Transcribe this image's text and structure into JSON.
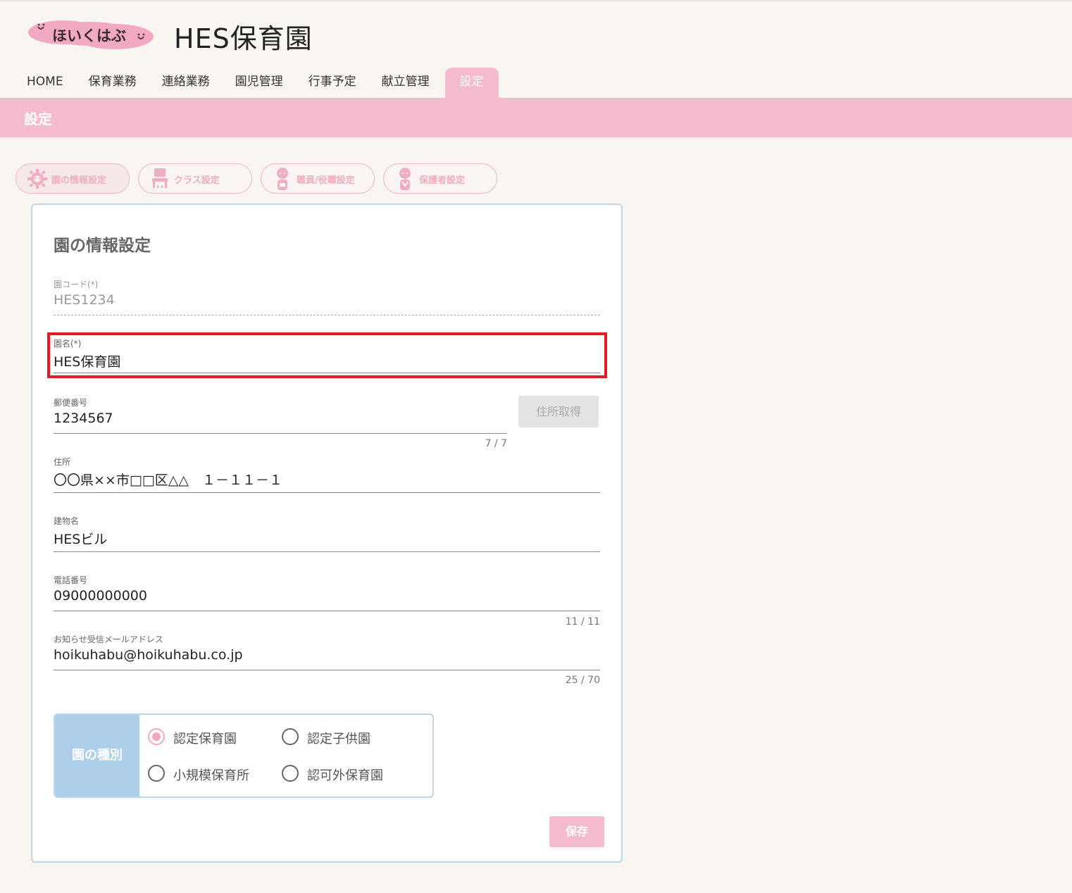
{
  "header": {
    "logo_text": "ほいくはぶ",
    "app_title": "HES保育園"
  },
  "nav": {
    "items": [
      {
        "label": "HOME"
      },
      {
        "label": "保育業務"
      },
      {
        "label": "連絡業務"
      },
      {
        "label": "園児管理"
      },
      {
        "label": "行事予定"
      },
      {
        "label": "献立管理"
      },
      {
        "label": "設定",
        "active": true
      }
    ]
  },
  "section": {
    "title": "設定"
  },
  "setting_tabs": [
    {
      "label": "園の情報設定",
      "icon": "gear-icon",
      "active": true
    },
    {
      "label": "クラス設定",
      "icon": "class-icon"
    },
    {
      "label": "職員/役職設定",
      "icon": "staff-icon"
    },
    {
      "label": "保護者設定",
      "icon": "guardian-icon"
    }
  ],
  "form": {
    "title": "園の情報設定",
    "code": {
      "label": "園コード(*)",
      "value": "HES1234"
    },
    "name": {
      "label": "園名(*)",
      "value": "HES保育園"
    },
    "postal": {
      "label": "郵便番号",
      "value": "1234567",
      "counter": "7 / 7",
      "button": "住所取得"
    },
    "address": {
      "label": "住所",
      "value": "〇〇県××市□□区△△　１－１１－１"
    },
    "building": {
      "label": "建物名",
      "value": "HESビル"
    },
    "phone": {
      "label": "電話番号",
      "value": "09000000000",
      "counter": "11 / 11"
    },
    "email": {
      "label": "お知らせ受信メールアドレス",
      "value": "hoikuhabu@hoikuhabu.co.jp",
      "counter": "25 / 70"
    },
    "kind": {
      "label": "園の種別",
      "options": [
        {
          "label": "認定保育園",
          "checked": true
        },
        {
          "label": "認定子供園",
          "checked": false
        },
        {
          "label": "小規模保育所",
          "checked": false
        },
        {
          "label": "認可外保育園",
          "checked": false
        }
      ]
    },
    "save_label": "保存"
  },
  "colors": {
    "accent_pink": "#f4bace",
    "accent_blue": "#aecfea",
    "highlight_red": "#e31b23",
    "background": "#f9f6f1"
  }
}
